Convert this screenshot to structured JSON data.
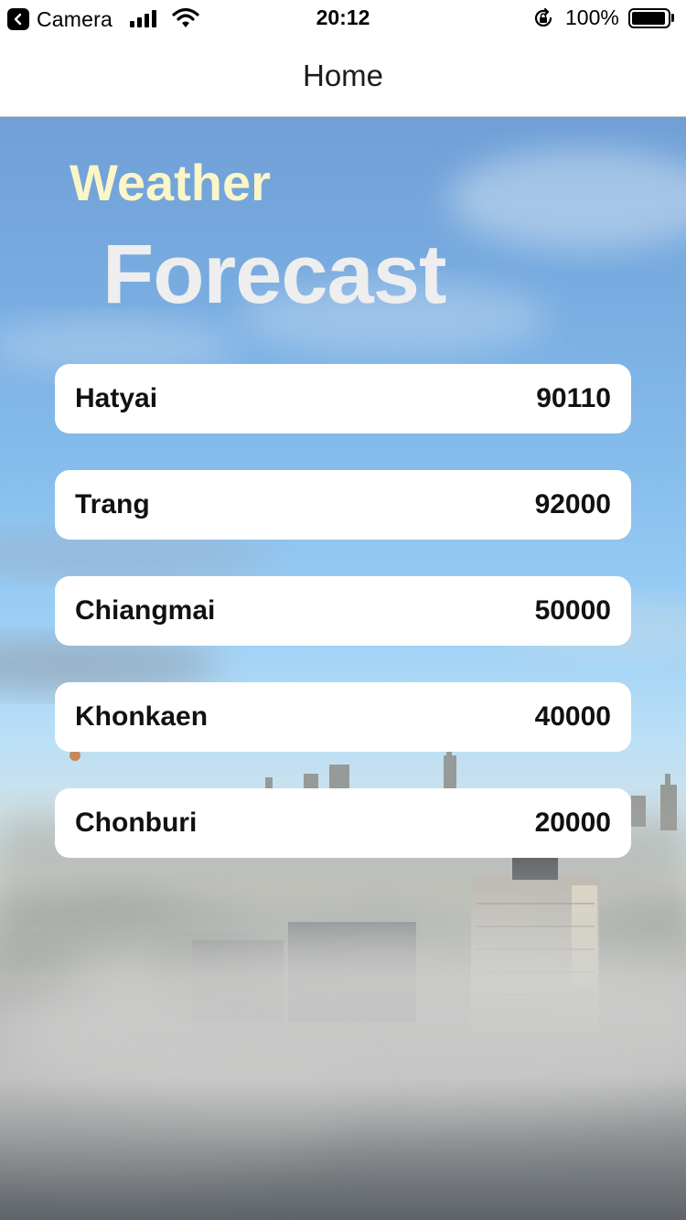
{
  "status_bar": {
    "back_app": "Camera",
    "time": "20:12",
    "battery_percent": "100%",
    "battery_level": 1.0,
    "signal_bars": 4,
    "icons": [
      "chevron-left-icon",
      "cellular-signal-icon",
      "wifi-icon",
      "orientation-lock-icon",
      "battery-icon"
    ]
  },
  "nav": {
    "title": "Home"
  },
  "header": {
    "line1": "Weather",
    "line2": "Forecast",
    "line1_color": "#fbf6c8",
    "line2_color": "#eeeeee"
  },
  "cities": [
    {
      "name": "Hatyai",
      "code": "90110"
    },
    {
      "name": "Trang",
      "code": "92000"
    },
    {
      "name": "Chiangmai",
      "code": "50000"
    },
    {
      "name": "Khonkaen",
      "code": "40000"
    },
    {
      "name": "Chonburi",
      "code": "20000"
    }
  ]
}
